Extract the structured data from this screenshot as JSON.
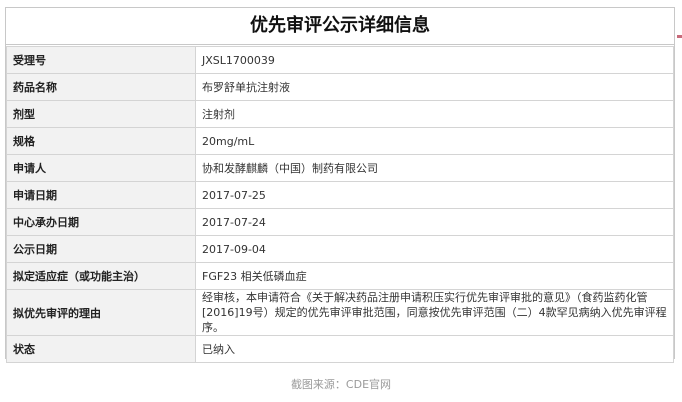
{
  "title": "优先审评公示详细信息",
  "rows": [
    {
      "label": "受理号",
      "value": "JXSL1700039"
    },
    {
      "label": "药品名称",
      "value": "布罗舒单抗注射液"
    },
    {
      "label": "剂型",
      "value": "注射剂"
    },
    {
      "label": "规格",
      "value": "20mg/mL"
    },
    {
      "label": "申请人",
      "value": "协和发酵麒麟（中国）制药有限公司"
    },
    {
      "label": "申请日期",
      "value": "2017-07-25"
    },
    {
      "label": "中心承办日期",
      "value": "2017-07-24"
    },
    {
      "label": "公示日期",
      "value": "2017-09-04"
    },
    {
      "label": "拟定适应症（或功能主治）",
      "value": "FGF23 相关低磷血症"
    },
    {
      "label": "拟优先审评的理由",
      "value": "经审核，本申请符合《关于解决药品注册申请积压实行优先审评审批的意见》（食药监药化管[2016]19号）规定的优先审评审批范围，同意按优先审评范围（二）4款罕见病纳入优先审评程序。"
    },
    {
      "label": "状态",
      "value": "已纳入"
    }
  ],
  "caption": "截图来源：CDE官网"
}
